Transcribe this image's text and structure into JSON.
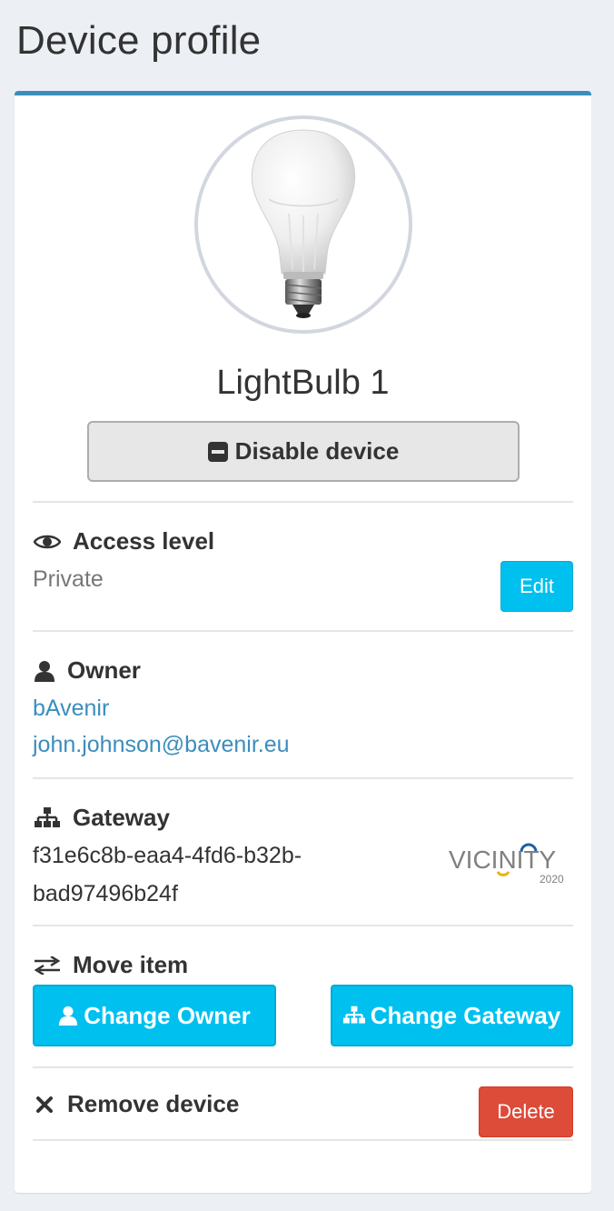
{
  "page": {
    "title": "Device profile"
  },
  "device": {
    "name": "LightBulb 1",
    "disable_label": "Disable device"
  },
  "access": {
    "heading": "Access level",
    "value": "Private",
    "edit_label": "Edit"
  },
  "owner": {
    "heading": "Owner",
    "organisation": "bAvenir",
    "email": "john.johnson@bavenir.eu"
  },
  "gateway": {
    "heading": "Gateway",
    "id_line1": "f31e6c8b-eaa4-4fd6-b32b-",
    "id_line2": "bad97496b24f",
    "logo_text": "VICINITY",
    "logo_year": "2020"
  },
  "move": {
    "heading": "Move item",
    "change_owner_label": "Change Owner",
    "change_gateway_label": "Change Gateway"
  },
  "remove": {
    "heading": "Remove device",
    "delete_label": "Delete"
  },
  "colors": {
    "accent": "#3c8dbc",
    "info": "#00c0ef",
    "danger": "#dd4b39",
    "background": "#ecf0f5"
  }
}
